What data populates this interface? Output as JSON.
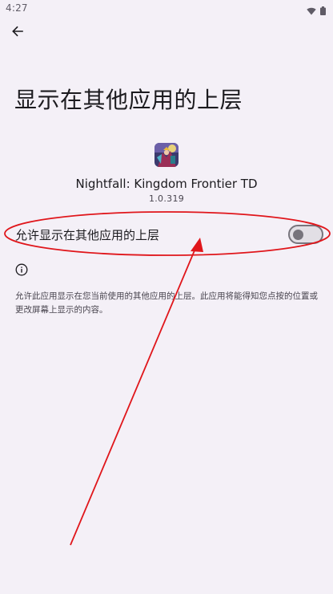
{
  "status_bar": {
    "time": "4:27",
    "icons": [
      "wifi-icon",
      "battery-icon"
    ]
  },
  "header": {
    "back_icon": "arrow-back-icon",
    "title": "显示在其他应用的上层"
  },
  "app": {
    "name": "Nightfall: Kingdom Frontier TD",
    "version": "1.0.319"
  },
  "permission": {
    "label": "允许显示在其他应用的上层",
    "enabled": false
  },
  "info": {
    "icon": "info-icon",
    "text": "允许此应用显示在您当前使用的其他应用的上层。此应用将能得知您点按的位置或更改屏幕上显示的内容。"
  },
  "colors": {
    "background": "#f4f0f7",
    "annotation_red": "#e0161b",
    "switch_outline": "#77747c"
  }
}
